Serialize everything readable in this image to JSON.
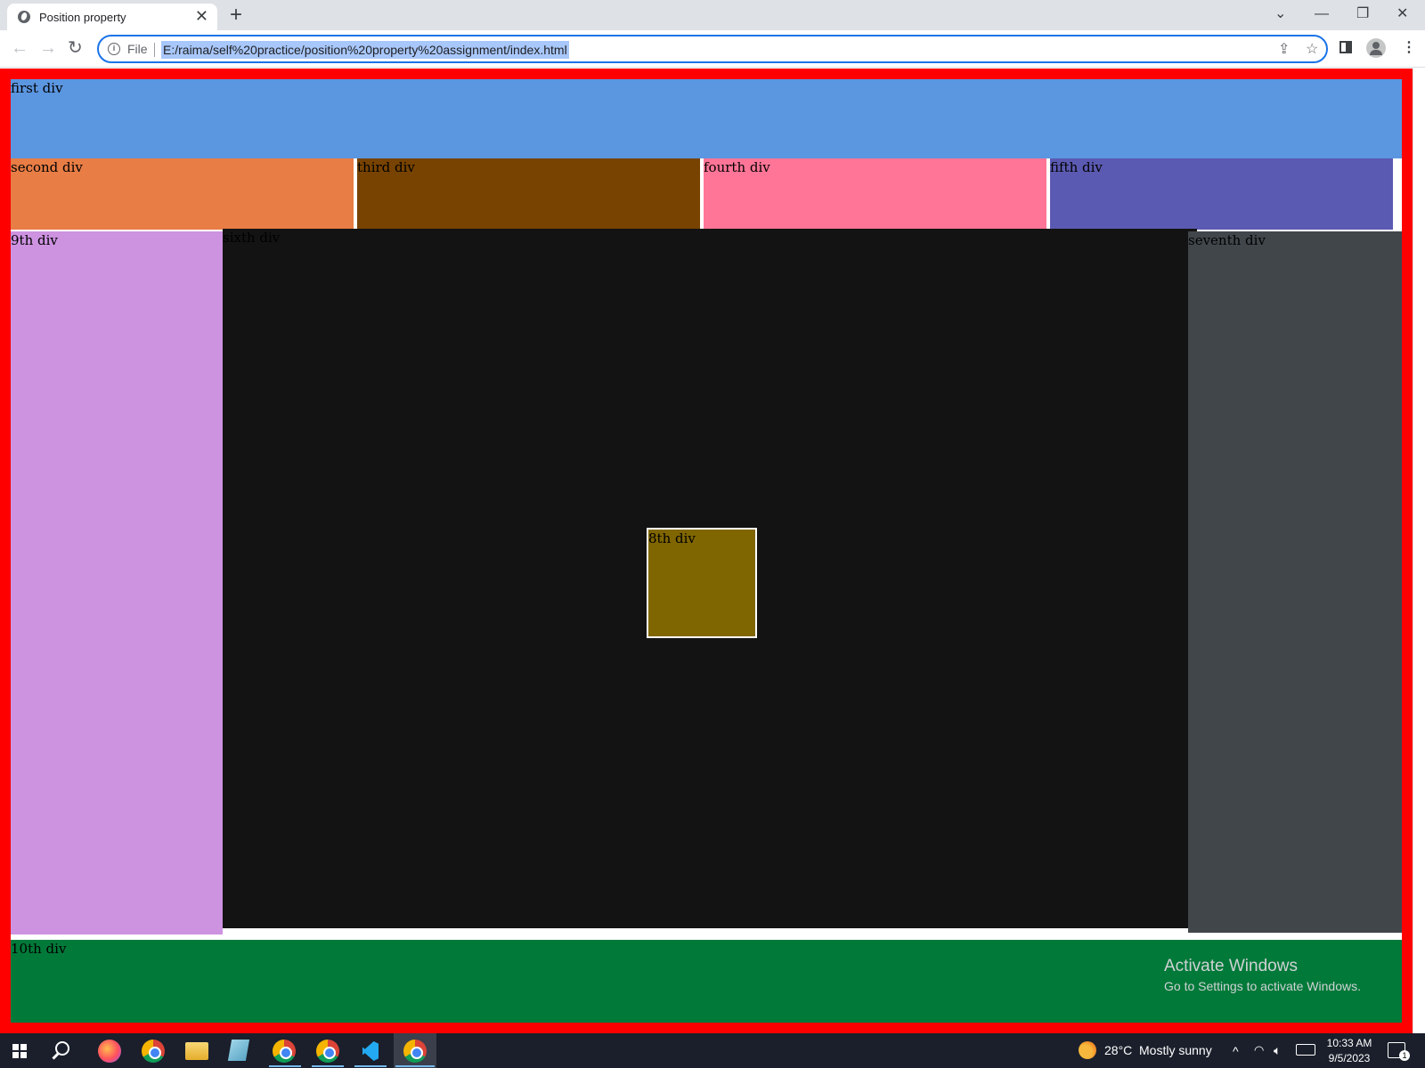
{
  "browser": {
    "tab_title": "Position property",
    "tab_close": "✕",
    "new_tab": "+",
    "file_label": "File",
    "url": "E:/raima/self%20practice/position%20property%20assignment/index.html",
    "window_controls": {
      "dropdown": "⌄",
      "minimize": "—",
      "restore": "❐",
      "close": "✕"
    },
    "nav": {
      "back": "←",
      "forward": "→",
      "reload": "↻"
    },
    "menu_icon": "⋮",
    "share_icon": "⇪",
    "star_icon": "☆"
  },
  "page": {
    "first": "first div",
    "second": "second div",
    "third": "third div",
    "fourth": "fourth div",
    "fifth": "fifth div",
    "sixth": "sixth div",
    "seventh": "seventh div",
    "eighth": "8th div",
    "ninth": "9th div",
    "tenth": "10th div",
    "colors": {
      "container_border": "#ff0000",
      "first": "#5b96e0",
      "second": "#e87d45",
      "third": "#784300",
      "fourth": "#ff7597",
      "fifth": "#5b5ab2",
      "sixth": "#131313",
      "seventh": "#41464b",
      "eighth": "#806600",
      "ninth": "#cd92e0",
      "tenth": "#017939"
    }
  },
  "watermark": {
    "title": "Activate Windows",
    "subtitle": "Go to Settings to activate Windows."
  },
  "taskbar": {
    "temperature": "28°C",
    "weather": "Mostly sunny",
    "tray_chevron": "^",
    "time": "10:33 AM",
    "date": "9/5/2023",
    "notification_count": "1"
  }
}
